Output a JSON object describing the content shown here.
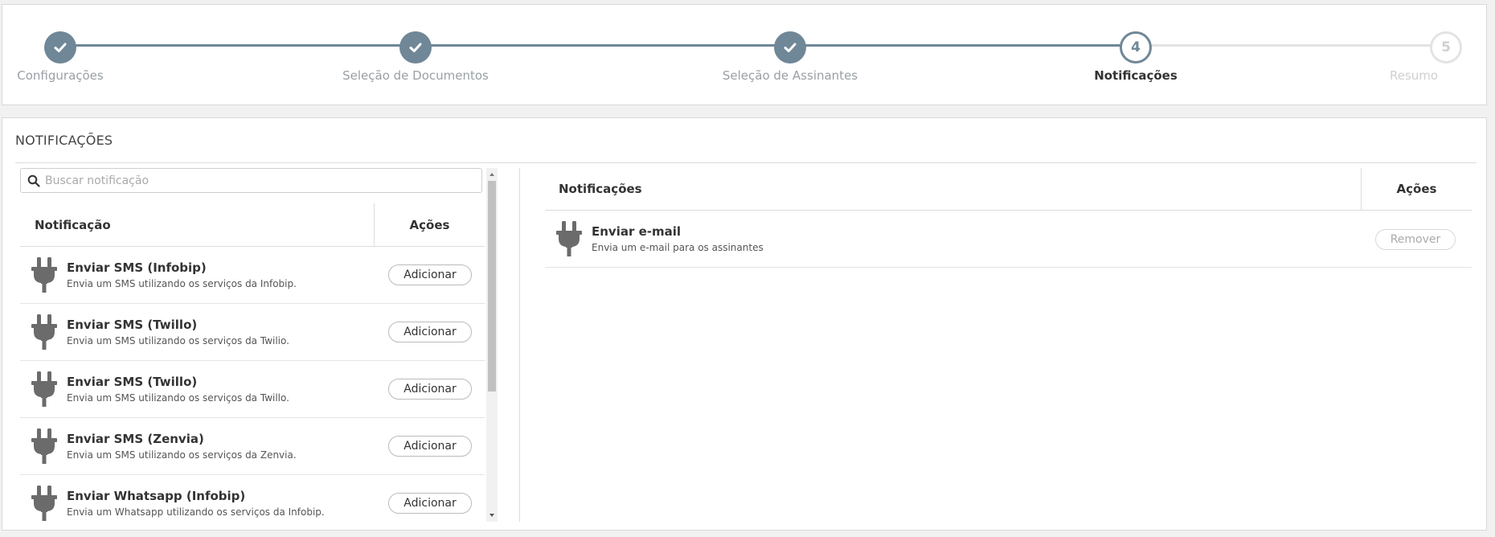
{
  "stepper": {
    "colors": {
      "done": "#6f8797",
      "pending": "#e3e3e3"
    },
    "steps": [
      {
        "label": "Configurações",
        "state": "done",
        "number": "1"
      },
      {
        "label": "Seleção de Documentos",
        "state": "done",
        "number": "2"
      },
      {
        "label": "Seleção de Assinantes",
        "state": "done",
        "number": "3"
      },
      {
        "label": "Notificações",
        "state": "current",
        "number": "4"
      },
      {
        "label": "Resumo",
        "state": "todo",
        "number": "5"
      }
    ]
  },
  "section": {
    "title": "NOTIFICAÇÕES"
  },
  "available": {
    "search_placeholder": "Buscar notificação",
    "col_name": "Notificação",
    "col_actions": "Ações",
    "add_label": "Adicionar",
    "items": [
      {
        "name": "Enviar SMS (Infobip)",
        "desc": "Envia um SMS utilizando os serviços da Infobip."
      },
      {
        "name": "Enviar SMS (Twillo)",
        "desc": "Envia um SMS utilizando os serviços da Twilio."
      },
      {
        "name": "Enviar SMS (Twillo)",
        "desc": "Envia um SMS utilizando os serviços da Twillo."
      },
      {
        "name": "Enviar SMS (Zenvia)",
        "desc": "Envia um SMS utilizando os serviços da Zenvia."
      },
      {
        "name": "Enviar Whatsapp (Infobip)",
        "desc": "Envia um Whatsapp utilizando os serviços da Infobip."
      }
    ]
  },
  "selected": {
    "col_name": "Notificações",
    "col_actions": "Ações",
    "remove_label": "Remover",
    "items": [
      {
        "name": "Enviar e-mail",
        "desc": "Envia um e-mail para os assinantes"
      }
    ]
  },
  "icons": {
    "row_icon": "plug-icon",
    "search": "search-icon",
    "step_done": "check-icon"
  }
}
